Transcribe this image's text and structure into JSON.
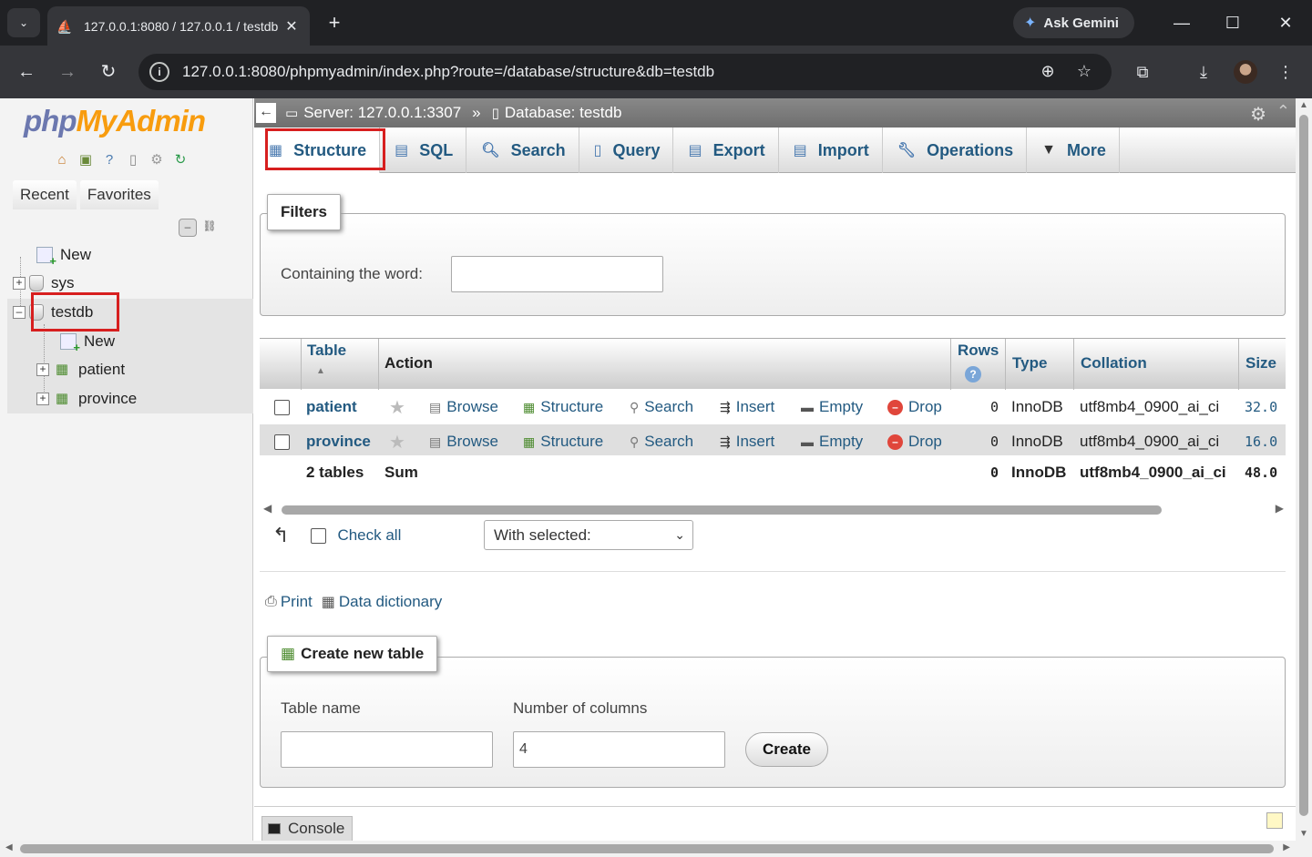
{
  "browser": {
    "tab_title": "127.0.0.1:8080 / 127.0.0.1 / testdb",
    "tab_close": "✕",
    "new_tab": "+",
    "ask_gemini": "Ask Gemini",
    "url": "127.0.0.1:8080/phpmyadmin/index.php?route=/database/structure&db=testdb"
  },
  "nav": {
    "logo_php": "php",
    "logo_myadmin": "MyAdmin",
    "tabs": [
      "Recent",
      "Favorites"
    ],
    "tree": {
      "new": "New",
      "dbs": [
        "sys",
        "testdb"
      ],
      "testdb_children": [
        "New",
        "patient",
        "province"
      ]
    }
  },
  "breadcrumb": {
    "server": "Server: 127.0.0.1:3307",
    "separator": "»",
    "database": "Database: testdb"
  },
  "menu": [
    "Structure",
    "SQL",
    "Search",
    "Query",
    "Export",
    "Import",
    "Operations",
    "More"
  ],
  "filters": {
    "legend": "Filters",
    "label": "Containing the word:",
    "value": ""
  },
  "table": {
    "headers": {
      "table": "Table",
      "action": "Action",
      "rows": "Rows",
      "type": "Type",
      "collation": "Collation",
      "size": "Size"
    },
    "actions": [
      "Browse",
      "Structure",
      "Search",
      "Insert",
      "Empty",
      "Drop"
    ],
    "rows": [
      {
        "name": "patient",
        "rows": "0",
        "type": "InnoDB",
        "collation": "utf8mb4_0900_ai_ci",
        "size": "32.0"
      },
      {
        "name": "province",
        "rows": "0",
        "type": "InnoDB",
        "collation": "utf8mb4_0900_ai_ci",
        "size": "16.0"
      }
    ],
    "summary": {
      "count": "2 tables",
      "label": "Sum",
      "rows": "0",
      "type": "InnoDB",
      "collation": "utf8mb4_0900_ai_ci",
      "size": "48.0"
    }
  },
  "bulk": {
    "check_all": "Check all",
    "with_selected": "With selected:"
  },
  "links": {
    "print": "Print",
    "data_dictionary": "Data dictionary"
  },
  "create": {
    "legend": "Create new table",
    "table_name_label": "Table name",
    "table_name_value": "",
    "columns_label": "Number of columns",
    "columns_value": "4",
    "button": "Create"
  },
  "console": {
    "label": "Console"
  },
  "colors": {
    "link": "#235a81",
    "highlight": "#d71f1f",
    "accent_orange": "#f89c0e",
    "accent_purple": "#6c78af"
  }
}
